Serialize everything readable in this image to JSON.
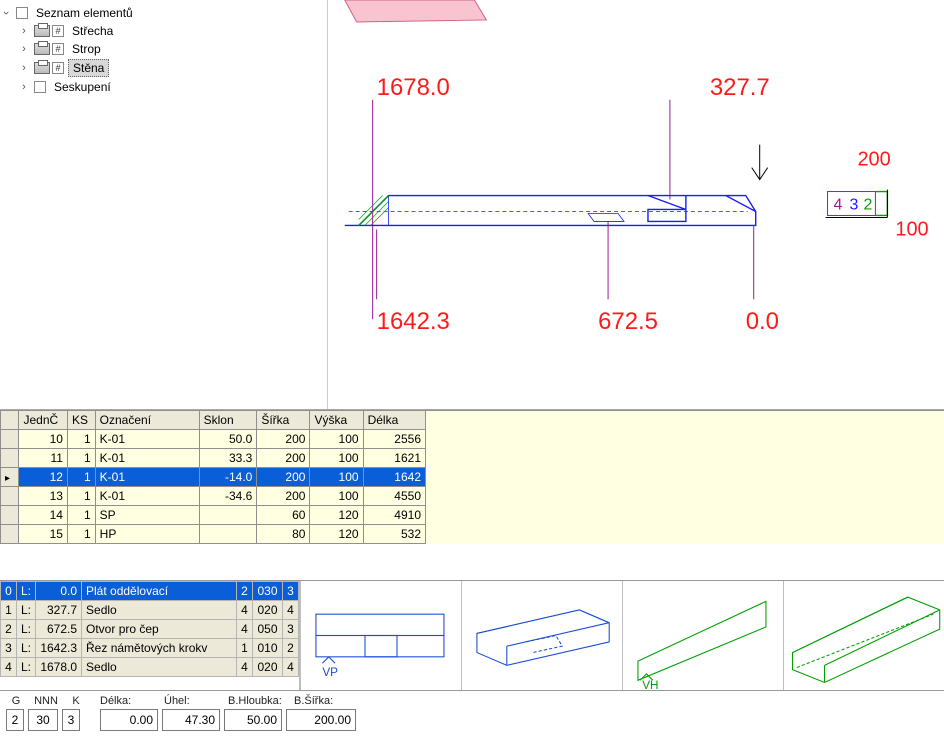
{
  "tree": {
    "root_label": "Seznam elementů",
    "items": [
      "Střecha",
      "Strop",
      "Stěna",
      "Seskupení"
    ],
    "selected_index": 2
  },
  "dimensions": {
    "top_left": "1678.0",
    "top_right": "327.7",
    "bottom_left": "1642.3",
    "bottom_mid": "672.5",
    "bottom_right": "0.0",
    "section_w": "200",
    "section_h": "100",
    "section_x": "4",
    "section_y": "3",
    "section_z": "2"
  },
  "elements_table": {
    "headers": [
      "JednČ",
      "KS",
      "Označení",
      "Sklon",
      "Šířka",
      "Výška",
      "Délka"
    ],
    "rows": [
      {
        "n": "10",
        "ks": "1",
        "label": "K-01",
        "slope": "50.0",
        "w": "200",
        "h": "100",
        "len": "2556"
      },
      {
        "n": "11",
        "ks": "1",
        "label": "K-01",
        "slope": "33.3",
        "w": "200",
        "h": "100",
        "len": "1621"
      },
      {
        "n": "12",
        "ks": "1",
        "label": "K-01",
        "slope": "-14.0",
        "w": "200",
        "h": "100",
        "len": "1642"
      },
      {
        "n": "13",
        "ks": "1",
        "label": "K-01",
        "slope": "-34.6",
        "w": "200",
        "h": "100",
        "len": "4550"
      },
      {
        "n": "14",
        "ks": "1",
        "label": "SP",
        "slope": "",
        "w": "60",
        "h": "120",
        "len": "4910"
      },
      {
        "n": "15",
        "ks": "1",
        "label": "HP",
        "slope": "",
        "w": "80",
        "h": "120",
        "len": "532"
      }
    ],
    "selected_index": 2
  },
  "operations": {
    "rows": [
      {
        "i": "0",
        "lp": "L:",
        "pos": "0.0",
        "name": "Plát oddělovací",
        "a": "2",
        "b": "030",
        "c": "3"
      },
      {
        "i": "1",
        "lp": "L:",
        "pos": "327.7",
        "name": "Sedlo",
        "a": "4",
        "b": "020",
        "c": "4"
      },
      {
        "i": "2",
        "lp": "L:",
        "pos": "672.5",
        "name": "Otvor pro čep",
        "a": "4",
        "b": "050",
        "c": "3"
      },
      {
        "i": "3",
        "lp": "L:",
        "pos": "1642.3",
        "name": "Řez námětových krokv",
        "a": "1",
        "b": "010",
        "c": "2"
      },
      {
        "i": "4",
        "lp": "L:",
        "pos": "1678.0",
        "name": "Sedlo",
        "a": "4",
        "b": "020",
        "c": "4"
      }
    ],
    "selected_index": 0
  },
  "thumb_labels": {
    "vp": "VP",
    "vh": "VH"
  },
  "bottom": {
    "labels": {
      "g": "G",
      "nnn": "NNN",
      "k": "K",
      "delka": "Délka:",
      "uhel": "Úhel:",
      "hloubka": "B.Hloubka:",
      "sirka": "B.Šířka:"
    },
    "values": {
      "g": "2",
      "nnn": "30",
      "k": "3",
      "delka": "0.00",
      "uhel": "47.30",
      "hloubka": "50.00",
      "sirka": "200.00"
    }
  }
}
